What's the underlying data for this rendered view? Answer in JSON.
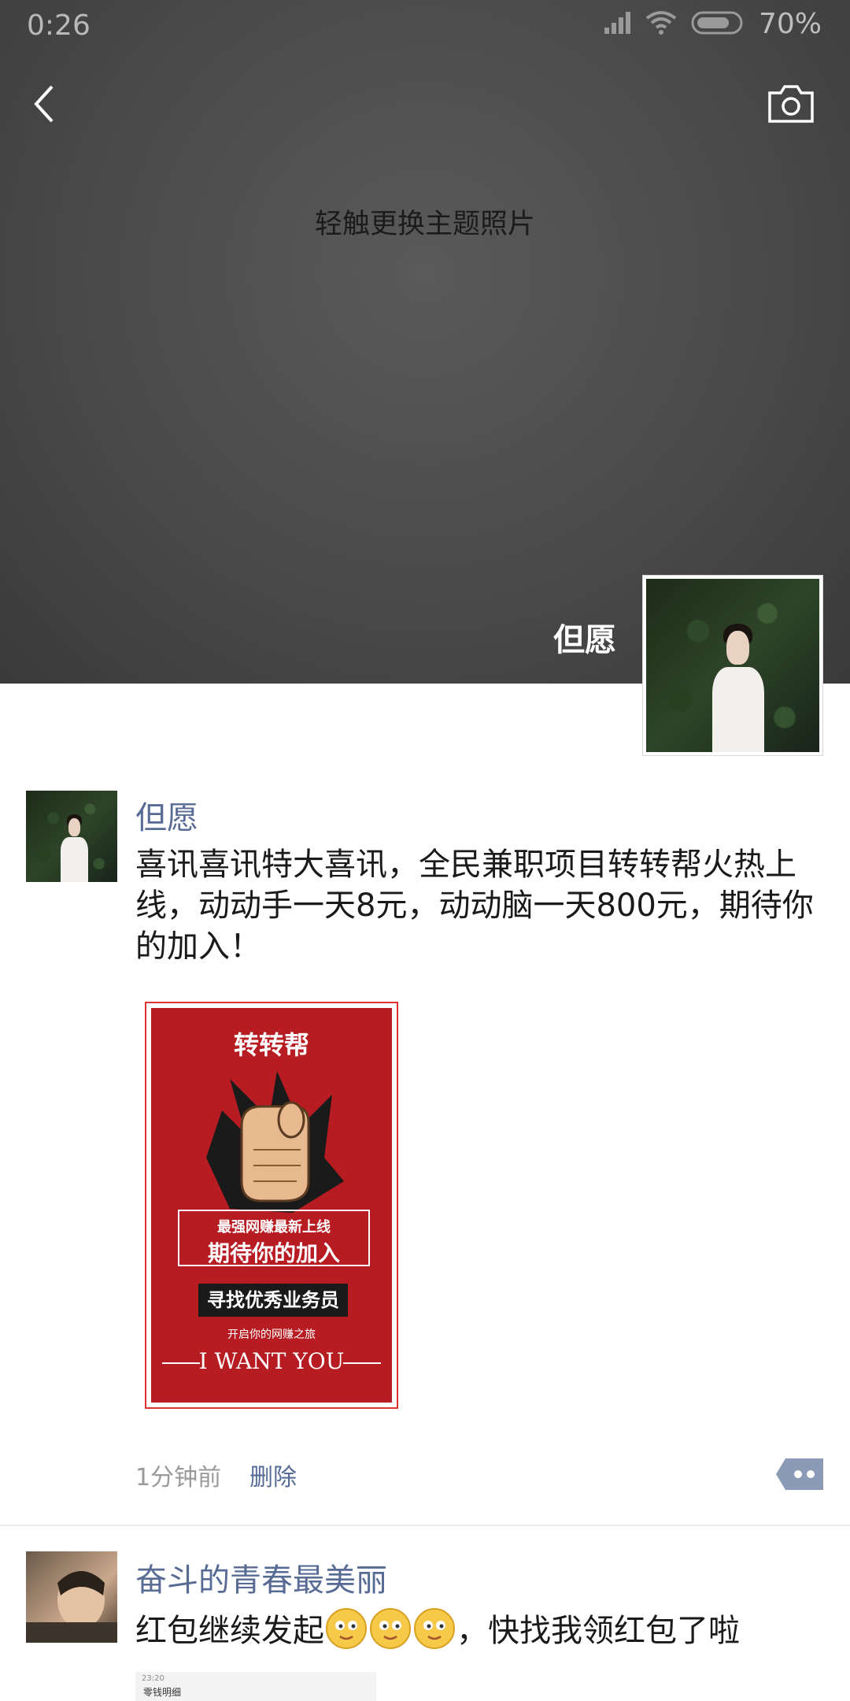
{
  "status_bar": {
    "time": "0:26",
    "battery_pct": "70%",
    "signal_icon": "signal-icon",
    "wifi_icon": "wifi-icon",
    "battery_icon": "battery-icon"
  },
  "header": {
    "back_icon": "back-chevron-icon",
    "camera_icon": "camera-icon",
    "theme_hint": "轻触更换主题照片"
  },
  "profile": {
    "name": "但愿"
  },
  "posts": [
    {
      "author": "但愿",
      "text": "喜讯喜讯特大喜讯，全民兼职项目转转帮火热上线，动动手一天8元，动动脑一天800元，期待你的加入！",
      "image": {
        "title": "转转帮",
        "box_line1": "最强网赚最新上线",
        "box_line2": "期待你的加入",
        "banner": "寻找优秀业务员",
        "subtitle": "开启你的网赚之旅",
        "tagline": "I WANT YOU"
      },
      "time": "1分钟前",
      "delete_label": "删除"
    },
    {
      "author": "奋斗的青春最美丽",
      "text_before": "红包继续发起",
      "text_after": "，快找我领红包了啦",
      "preview": {
        "status": "23:20",
        "text": "零钱明细"
      }
    }
  ],
  "colors": {
    "link": "#576b95",
    "header_bg": "#4a4a4a",
    "poster_red": "#b71c22"
  }
}
